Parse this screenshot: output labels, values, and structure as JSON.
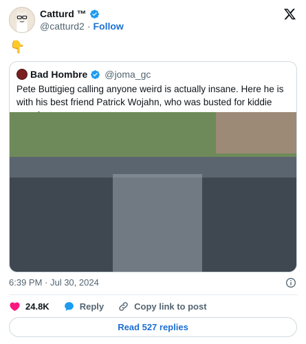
{
  "author": {
    "display_name": "Catturd ™",
    "handle": "@catturd2",
    "separator": "·",
    "follow_label": "Follow"
  },
  "tweet": {
    "text": "👇"
  },
  "quoted": {
    "display_name": "Bad Hombre",
    "handle": "@joma_gc",
    "text": "Pete Buttigieg calling anyone weird is actually insane. Here he is with his best friend Patrick Wojahn, who was busted for kiddie porn last year."
  },
  "timestamp": "6:39 PM · Jul 30, 2024",
  "actions": {
    "like_count": "24.8K",
    "reply_label": "Reply",
    "copy_label": "Copy link to post"
  },
  "replies_button_label": "Read 527 replies",
  "colors": {
    "accent_blue": "#1d9bf0",
    "link_blue": "#1d6fd1",
    "like_red": "#f91880",
    "muted": "#536471",
    "border": "#cfd9de"
  },
  "icons": [
    "verified-badge-icon",
    "x-logo-icon",
    "info-icon",
    "heart-icon",
    "reply-bubble-icon",
    "link-icon"
  ]
}
